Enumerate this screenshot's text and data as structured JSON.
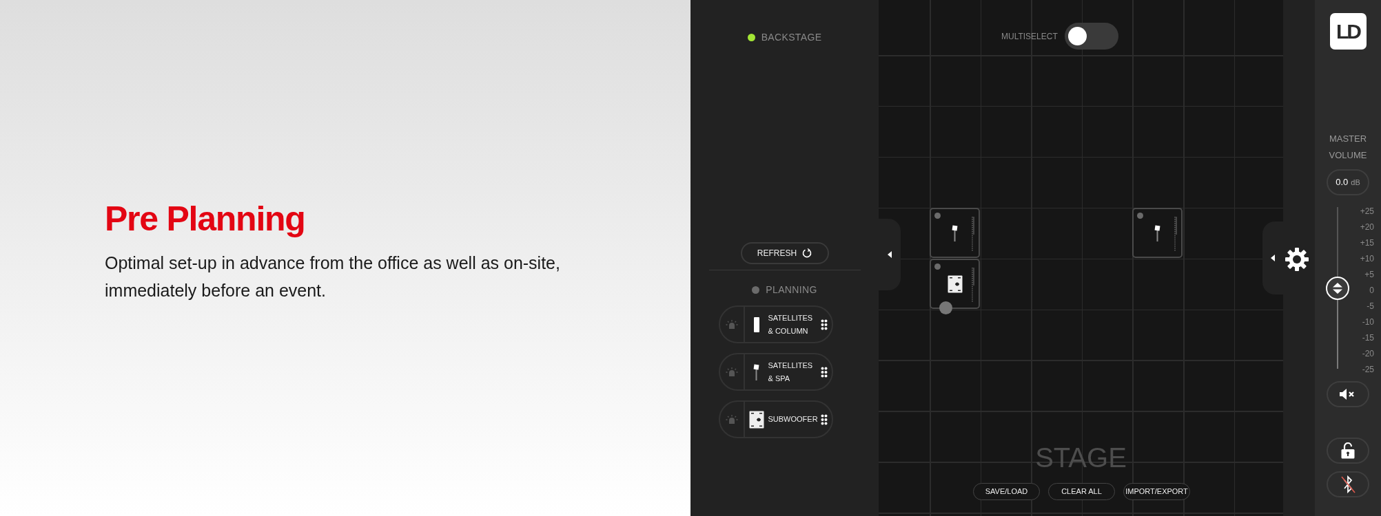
{
  "hero": {
    "title": "Pre Planning",
    "text": "Optimal set-up in advance from the office as well as on-site, immediately before an event."
  },
  "left_panel": {
    "backstage": {
      "label": "BACKSTAGE",
      "active": true
    },
    "refresh_button": "REFRESH",
    "planning": {
      "label": "PLANNING",
      "active": false
    },
    "devices": [
      {
        "kind": "column",
        "label": "SATELLITES & COLUMN"
      },
      {
        "kind": "spa",
        "label": "SATELLITES & SPA"
      },
      {
        "kind": "subwoofer",
        "label": "SUBWOOFER"
      }
    ]
  },
  "stage": {
    "multiselect": {
      "label": "MULTISELECT",
      "on": false
    },
    "devices": [
      {
        "kind": "spa",
        "dragging": false
      },
      {
        "kind": "subwoofer",
        "dragging": true
      },
      {
        "kind": "spa",
        "dragging": false
      }
    ],
    "title": "STAGE",
    "buttons": [
      "SAVE/LOAD",
      "CLEAR ALL",
      "IMPORT/EXPORT"
    ]
  },
  "right_panel": {
    "logo": "LD",
    "master_volume": {
      "label": "MASTER VOLUME",
      "value": "0.0",
      "unit": "dB",
      "level": 0.5,
      "scale": [
        "+25",
        "+20",
        "+15",
        "+10",
        "+5",
        "0",
        "-5",
        "-10",
        "-15",
        "-20",
        "-25"
      ]
    }
  }
}
